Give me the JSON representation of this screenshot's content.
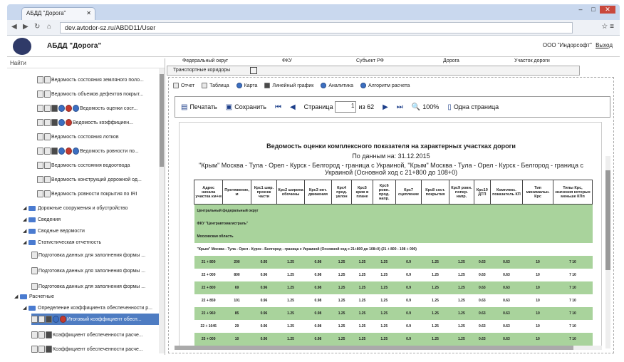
{
  "browser": {
    "tab_title": "АБДД \"Дорога\"",
    "url": "dev.avtodor-sz.ru/ABDD11/User"
  },
  "app": {
    "title": "АБДД \"Дорога\"",
    "user": "ООО \"Индорсофт\"",
    "logout": "Выход"
  },
  "sidebar": {
    "search_label": "Найти",
    "items": [
      {
        "label": "Ведомость состояния земляного поло..."
      },
      {
        "label": "Ведомость объемов дефектов покрыт..."
      },
      {
        "label": "Ведомость оценки сост..."
      },
      {
        "label": "Ведомость коэффициен..."
      },
      {
        "label": "Ведомость состояния лотков"
      },
      {
        "label": "Ведомость ровности по..."
      },
      {
        "label": "Ведомость состояния водоотвода"
      },
      {
        "label": "Ведомость конструкций дорожной од..."
      },
      {
        "label": "Ведомость ровности покрытия по IRI"
      },
      {
        "label": "Дорожные сооружения и обустройство"
      },
      {
        "label": "Сведения"
      },
      {
        "label": "Сводные ведомости"
      },
      {
        "label": "Статистическая отчетность"
      },
      {
        "label": "Подготовка данных для заполнения формы ..."
      },
      {
        "label": "Подготовка данных для заполнения формы ..."
      },
      {
        "label": "Подготовка данных для заполнения формы ..."
      },
      {
        "label": "Расчетные"
      },
      {
        "label": "Определение коэффициента обеспеченности р..."
      },
      {
        "label": "Итоговый коэффициент обесп..."
      },
      {
        "label": "Коэффициент обеспеченности расче..."
      },
      {
        "label": "Коэффициент обеспеченности расче..."
      }
    ]
  },
  "filters": {
    "f1": "Федеральный округ",
    "f2": "ФКУ",
    "f3": "Субъект РФ",
    "f4": "Дорога",
    "f5": "Участок дороги",
    "corridor": "Транспортные коридоры"
  },
  "view_tabs": [
    "Отчет",
    "Таблица",
    "Карта",
    "Линейный график",
    "Аналитика",
    "Алгоритм расчета"
  ],
  "report_toolbar": {
    "print": "Печатать",
    "save": "Сохранить",
    "page_label": "Страница",
    "page_value": "1",
    "page_of": "из 62",
    "zoom": "100%",
    "single_page": "Одна страница"
  },
  "report": {
    "title": "Ведомость оценки комплексного показателя на характерных участках дороги",
    "date_line": "По данным на: 31.12.2015",
    "road_line": "\"Крым\" Москва - Тула - Орел - Курск - Белгород - граница с Украиной, \"Крым\" Москва - Тула - Орел - Курск - Белгород - граница с Украиной (Основной ход с 21+800 до 108+0)",
    "columns": [
      "Адрес начала участка км+м",
      "Протяжение, м",
      "Крс1 шир. проезж части",
      "Крс2 ширина обочины",
      "Крс3 инт. движения",
      "Крс4 прод. уклон",
      "Крс5 крив в плане",
      "Крс6 ровн. прод. напр.",
      "Крс7 сцепление",
      "Крс8 сост. покрытия",
      "Крс9 ровн. попер. напр.",
      "Крс10 ДТП",
      "Комплекс. показатель КП",
      "Тип минимальн. Крс",
      "Типы Крс, значения которых меньше КПп"
    ],
    "groups": [
      "Центральный федеральный округ",
      "ФКУ \"Центравтомагистраль\"",
      "Московская область",
      "\"Крым\" Москва - Тула - Орел - Курск - Белгород - граница с Украиной (Основной ход с 21+800 до 108+0) (21 + 800 - 108 + 000)"
    ],
    "rows": [
      [
        "21 + 800",
        "200",
        "0.95",
        "1.25",
        "0.98",
        "1.25",
        "1.25",
        "1.25",
        "0.9",
        "1.25",
        "1.25",
        "0.63",
        "0.63",
        "10",
        "7 10"
      ],
      [
        "22 + 000",
        "800",
        "0.96",
        "1.25",
        "0.98",
        "1.25",
        "1.25",
        "1.25",
        "0.9",
        "1.25",
        "1.25",
        "0.63",
        "0.63",
        "10",
        "7 10"
      ],
      [
        "22 + 800",
        "69",
        "0.96",
        "1.25",
        "0.98",
        "1.25",
        "1.25",
        "1.25",
        "0.9",
        "1.25",
        "1.25",
        "0.63",
        "0.63",
        "10",
        "7 10"
      ],
      [
        "22 + 859",
        "101",
        "0.96",
        "1.25",
        "0.98",
        "1.25",
        "1.25",
        "1.25",
        "0.9",
        "1.25",
        "1.25",
        "0.63",
        "0.63",
        "10",
        "7 10"
      ],
      [
        "22 + 960",
        "85",
        "0.96",
        "1.25",
        "0.98",
        "1.25",
        "1.25",
        "1.25",
        "0.9",
        "1.25",
        "1.25",
        "0.63",
        "0.63",
        "10",
        "7 10"
      ],
      [
        "22 + 1045",
        "29",
        "0.96",
        "1.25",
        "0.98",
        "1.25",
        "1.25",
        "1.25",
        "0.9",
        "1.25",
        "1.25",
        "0.63",
        "0.63",
        "10",
        "7 10"
      ],
      [
        "25 + 000",
        "10",
        "0.96",
        "1.25",
        "0.98",
        "1.25",
        "1.25",
        "1.25",
        "0.9",
        "1.25",
        "1.25",
        "0.63",
        "0.63",
        "10",
        "7 10"
      ],
      [
        "25 + 010",
        "62",
        "0.96",
        "1.25",
        "0.98",
        "1.25",
        "1.25",
        "1.25",
        "0.9",
        "1.25",
        "1.25",
        "0.63",
        "0.63",
        "10",
        "7 10"
      ]
    ]
  }
}
